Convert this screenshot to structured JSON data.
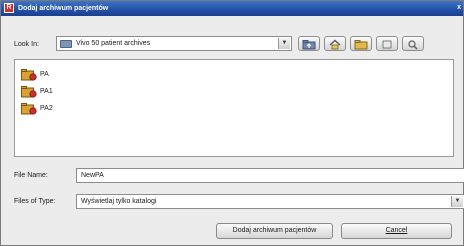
{
  "window": {
    "title": "Dodaj archiwum pacjentów",
    "title_icon_letter": "R",
    "close_glyph": "x",
    "titlebar_color": "#2452a8"
  },
  "look_in": {
    "label": "Look In:",
    "value": "Vivo 50 patient archives"
  },
  "toolbar": {
    "buttons": [
      {
        "name": "up-one-level",
        "icon": "folder-up-icon"
      },
      {
        "name": "home",
        "icon": "home-icon"
      },
      {
        "name": "new-folder",
        "icon": "new-folder-icon"
      },
      {
        "name": "list-view",
        "icon": "list-view-icon"
      },
      {
        "name": "details-view",
        "icon": "details-view-icon"
      }
    ]
  },
  "files": [
    {
      "name": "PA",
      "icon": "archive-icon"
    },
    {
      "name": "PA1",
      "icon": "archive-icon"
    },
    {
      "name": "PA2",
      "icon": "archive-icon"
    }
  ],
  "file_name": {
    "label": "File Name:",
    "value": "NewPA"
  },
  "file_type": {
    "label": "Files of Type:",
    "value": "Wyświetlaj tylko katalogi"
  },
  "buttons": {
    "approve": "Dodaj archiwum pacjentów",
    "cancel": "Cancel"
  },
  "colors": {
    "accent": "#2452a8",
    "archive_icon": "#d9a233"
  }
}
